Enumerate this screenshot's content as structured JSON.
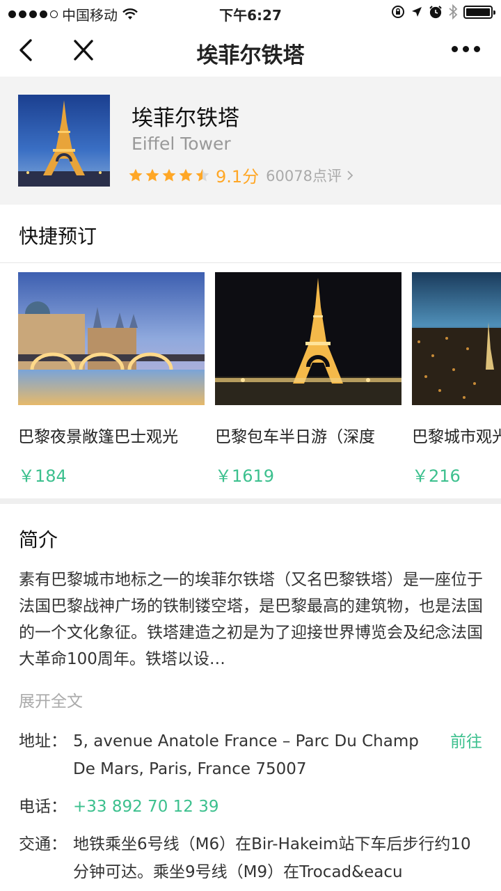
{
  "status_bar": {
    "carrier": "中国移动",
    "time": "下午6:27"
  },
  "nav": {
    "title": "埃菲尔铁塔"
  },
  "poi": {
    "name": "埃菲尔铁塔",
    "name_en": "Eiffel Tower",
    "rating_stars": 4.5,
    "score": "9.1分",
    "reviews": "60078点评"
  },
  "quick_booking": {
    "title": "快捷预订",
    "products": [
      {
        "name": "巴黎夜景敞篷巴士观光",
        "price": "￥184"
      },
      {
        "name": "巴黎包车半日游（深度",
        "price": "￥1619"
      },
      {
        "name": "巴黎城市观光",
        "price": "￥216"
      }
    ]
  },
  "intro": {
    "title": "简介",
    "text": "素有巴黎城市地标之一的埃菲尔铁塔（又名巴黎铁塔）是一座位于法国巴黎战神广场的铁制镂空塔，是巴黎最高的建筑物，也是法国的一个文化象征。铁塔建造之初是为了迎接世界博览会及纪念法国大革命100周年。铁塔以设…",
    "expand": "展开全文"
  },
  "info": {
    "address_label": "地址：",
    "address": "5, avenue Anatole France – Parc Du Champ De Mars, Paris, France 75007",
    "goto": "前往",
    "phone_label": "电话：",
    "phone": "+33 892 70 12 39",
    "transit_label": "交通：",
    "transit": "地铁乘坐6号线（M6）在Bir-Hakeim站下车后步行约10分钟可达。乘坐9号线（M9）在Trocad&eacu"
  },
  "colors": {
    "accent_green": "#3cc08e",
    "star_orange": "#ffa726"
  }
}
